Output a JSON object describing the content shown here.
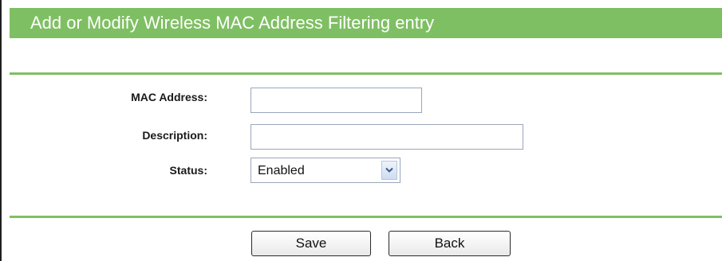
{
  "page": {
    "title": "Add or Modify Wireless MAC Address Filtering entry"
  },
  "form": {
    "mac_address": {
      "label": "MAC Address:",
      "value": ""
    },
    "description": {
      "label": "Description:",
      "value": ""
    },
    "status": {
      "label": "Status:",
      "selected": "Enabled",
      "icon": "chevron-down-icon"
    }
  },
  "buttons": {
    "save_label": "Save",
    "back_label": "Back"
  },
  "colors": {
    "accent_green": "#7fbf63",
    "field_border": "#9aa6b8"
  }
}
